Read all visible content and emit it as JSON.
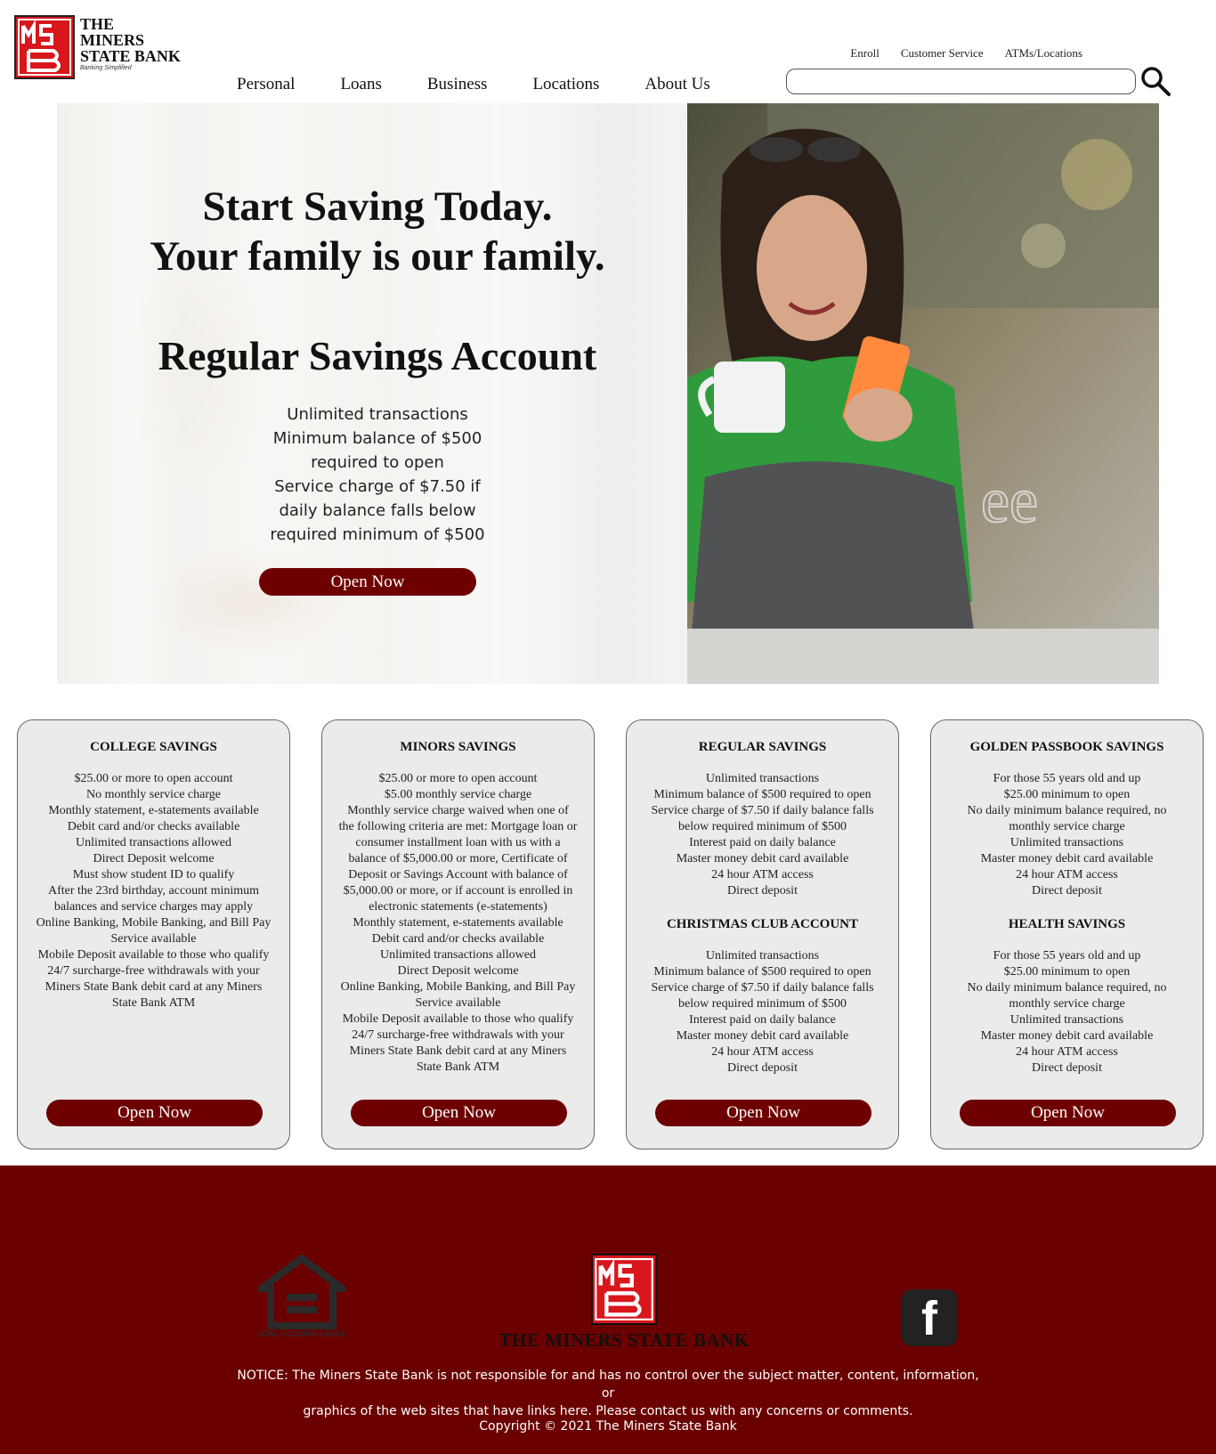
{
  "header": {
    "brand_name": "THE\nMINERS\nSTATE BANK",
    "brand_tagline": "Banking Simplified",
    "utility_nav": [
      "Enroll",
      "Customer Service",
      "ATMs/Locations"
    ],
    "main_nav": [
      "Personal",
      "Loans",
      "Business",
      "Locations",
      "About Us"
    ],
    "search": {
      "value": "",
      "placeholder": ""
    }
  },
  "hero": {
    "headline": "Start Saving Today.\nYour family is our family.",
    "subtitle": "Regular Savings Account",
    "body": "Unlimited transactions\nMinimum balance of $500 required to open\nService charge of $7.50 if daily balance falls below required minimum of $500",
    "cta": "Open Now"
  },
  "cards": [
    {
      "title": "COLLEGE SAVINGS",
      "lines": "$25.00 or more to open account\nNo monthly service charge\nMonthly statement, e-statements available\nDebit card and/or checks available\nUnlimited transactions allowed\nDirect Deposit welcome\nMust show student ID to qualify\nAfter the 23rd birthday, account minimum balances and service charges may apply\nOnline Banking, Mobile Banking, and Bill Pay Service available\nMobile Deposit available to those who qualify\n24/7 surcharge-free withdrawals with your Miners State Bank debit card at any Miners State Bank ATM",
      "cta": "Open Now"
    },
    {
      "title": "MINORS SAVINGS",
      "lines": "$25.00 or more to open account\n$5.00 monthly service charge\nMonthly service charge waived when one of the following criteria are met:  Mortgage loan or consumer installment loan with us with a balance of $5,000.00 or more, Certificate of Deposit or Savings Account with balance of $5,000.00 or more, or if account is enrolled in electronic statements (e-statements)\nMonthly statement, e-statements available\nDebit card and/or checks available\nUnlimited transactions allowed\nDirect Deposit welcome\nOnline Banking, Mobile Banking, and Bill Pay Service available\nMobile Deposit available to those who qualify\n24/7 surcharge-free withdrawals with your Miners State Bank debit card at any Miners State Bank ATM",
      "cta": "Open Now"
    },
    {
      "title": "REGULAR SAVINGS",
      "lines": "Unlimited transactions\nMinimum balance of $500 required to open\nService charge of $7.50 if daily balance falls below required minimum of $500\nInterest paid on daily balance\nMaster money debit card available\n24 hour ATM access\nDirect deposit",
      "title2": "CHRISTMAS CLUB ACCOUNT",
      "lines2": "Unlimited transactions\nMinimum balance of $500 required to open\nService charge of $7.50 if daily balance falls below required minimum of $500\nInterest paid on daily balance\nMaster money debit card available\n24 hour ATM access\nDirect deposit",
      "cta": "Open Now"
    },
    {
      "title": "GOLDEN PASSBOOK SAVINGS",
      "lines": "For those 55 years old and up\n$25.00 minimum to open\nNo daily minimum balance required, no monthly service charge\nUnlimited transactions\nMaster money debit card available\n24 hour ATM access\nDirect deposit",
      "title2": "HEALTH SAVINGS",
      "lines2": "For those 55 years old and up\n$25.00 minimum to open\nNo daily minimum balance required, no monthly service charge\nUnlimited transactions\nMaster money debit card available\n24 hour ATM access\nDirect deposit",
      "cta": "Open Now"
    }
  ],
  "footer": {
    "equal_housing_text": "EQUAL HOUSING LENDER",
    "bank_name": "THE MINERS STATE BANK",
    "facebook_glyph": "f",
    "notice": "NOTICE: The Miners State Bank is not responsible for and has no control over the subject matter, content, information, or\ngraphics of the web sites that have links here. Please contact us with any concerns or comments.",
    "copyright": "Copyright © 2021 The Miners State Bank"
  },
  "colors": {
    "brand_red": "#d8161c",
    "button_maroon": "#6f0000",
    "footer_bg": "#6a0000",
    "card_bg": "#ebebeb"
  },
  "icons": [
    "msb-logo-icon",
    "search-icon",
    "equal-housing-lender-icon",
    "facebook-icon"
  ]
}
